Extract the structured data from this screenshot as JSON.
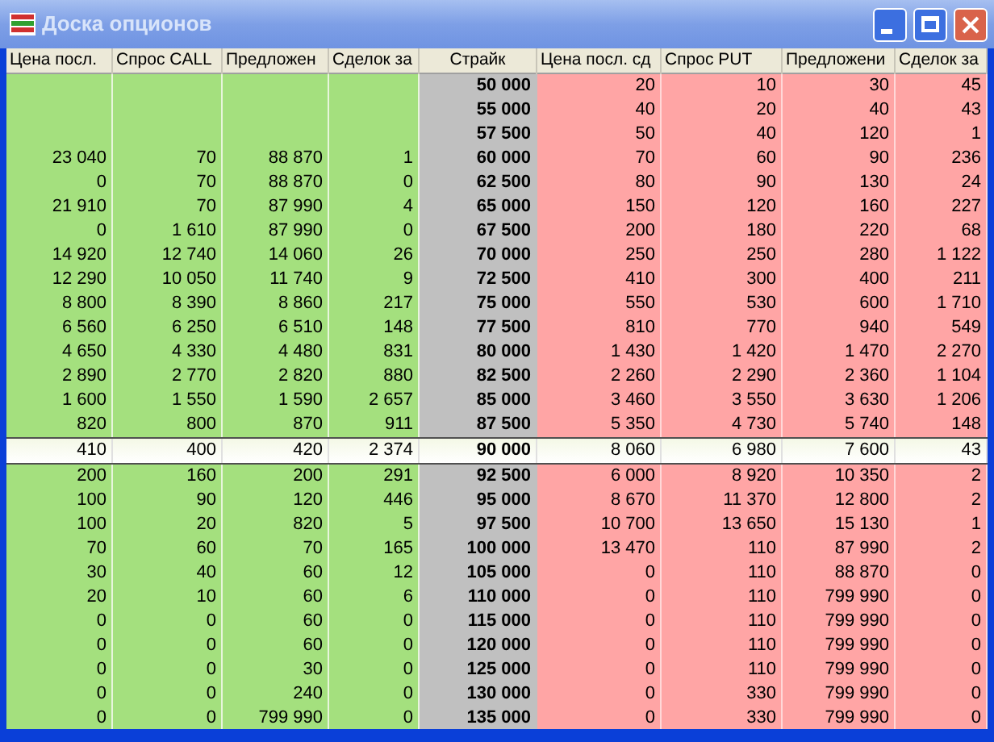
{
  "window": {
    "title": "Доска опционов"
  },
  "columns": [
    "Цена посл.",
    "Спрос CALL",
    "Предложен",
    "Сделок за",
    "Страйк",
    "Цена посл. сд",
    "Спрос PUT",
    "Предложени",
    "Сделок за"
  ],
  "rows": [
    {
      "strike": "50 000",
      "put": [
        "20",
        "10",
        "30",
        "45"
      ],
      "selected": false
    },
    {
      "strike": "55 000",
      "put": [
        "40",
        "20",
        "40",
        "43"
      ],
      "selected": false
    },
    {
      "strike": "57 500",
      "put": [
        "50",
        "40",
        "120",
        "1"
      ],
      "selected": false
    },
    {
      "strike": "60 000",
      "call": [
        "23 040",
        "70",
        "88 870",
        "1"
      ],
      "put": [
        "70",
        "60",
        "90",
        "236"
      ],
      "selected": false
    },
    {
      "strike": "62 500",
      "call": [
        "0",
        "70",
        "88 870",
        "0"
      ],
      "put": [
        "80",
        "90",
        "130",
        "24"
      ],
      "selected": false
    },
    {
      "strike": "65 000",
      "call": [
        "21 910",
        "70",
        "87 990",
        "4"
      ],
      "put": [
        "150",
        "120",
        "160",
        "227"
      ],
      "selected": false
    },
    {
      "strike": "67 500",
      "call": [
        "0",
        "1 610",
        "87 990",
        "0"
      ],
      "put": [
        "200",
        "180",
        "220",
        "68"
      ],
      "selected": false
    },
    {
      "strike": "70 000",
      "call": [
        "14 920",
        "12 740",
        "14 060",
        "26"
      ],
      "put": [
        "250",
        "250",
        "280",
        "1 122"
      ],
      "selected": false
    },
    {
      "strike": "72 500",
      "call": [
        "12 290",
        "10 050",
        "11 740",
        "9"
      ],
      "put": [
        "410",
        "300",
        "400",
        "211"
      ],
      "selected": false
    },
    {
      "strike": "75 000",
      "call": [
        "8 800",
        "8 390",
        "8 860",
        "217"
      ],
      "put": [
        "550",
        "530",
        "600",
        "1 710"
      ],
      "selected": false
    },
    {
      "strike": "77 500",
      "call": [
        "6 560",
        "6 250",
        "6 510",
        "148"
      ],
      "put": [
        "810",
        "770",
        "940",
        "549"
      ],
      "selected": false
    },
    {
      "strike": "80 000",
      "call": [
        "4 650",
        "4 330",
        "4 480",
        "831"
      ],
      "put": [
        "1 430",
        "1 420",
        "1 470",
        "2 270"
      ],
      "selected": false
    },
    {
      "strike": "82 500",
      "call": [
        "2 890",
        "2 770",
        "2 820",
        "880"
      ],
      "put": [
        "2 260",
        "2 290",
        "2 360",
        "1 104"
      ],
      "selected": false
    },
    {
      "strike": "85 000",
      "call": [
        "1 600",
        "1 550",
        "1 590",
        "2 657"
      ],
      "put": [
        "3 460",
        "3 550",
        "3 630",
        "1 206"
      ],
      "selected": false
    },
    {
      "strike": "87 500",
      "call": [
        "820",
        "800",
        "870",
        "911"
      ],
      "put": [
        "5 350",
        "4 730",
        "5 740",
        "148"
      ],
      "selected": false
    },
    {
      "strike": "90 000",
      "call": [
        "410",
        "400",
        "420",
        "2 374"
      ],
      "put": [
        "8 060",
        "6 980",
        "7 600",
        "43"
      ],
      "selected": true
    },
    {
      "strike": "92 500",
      "call": [
        "200",
        "160",
        "200",
        "291"
      ],
      "put": [
        "6 000",
        "8 920",
        "10 350",
        "2"
      ],
      "selected": false
    },
    {
      "strike": "95 000",
      "call": [
        "100",
        "90",
        "120",
        "446"
      ],
      "put": [
        "8 670",
        "11 370",
        "12 800",
        "2"
      ],
      "selected": false
    },
    {
      "strike": "97 500",
      "call": [
        "100",
        "20",
        "820",
        "5"
      ],
      "put": [
        "10 700",
        "13 650",
        "15 130",
        "1"
      ],
      "selected": false
    },
    {
      "strike": "100 000",
      "call": [
        "70",
        "60",
        "70",
        "165"
      ],
      "put": [
        "13 470",
        "110",
        "87 990",
        "2"
      ],
      "selected": false
    },
    {
      "strike": "105 000",
      "call": [
        "30",
        "40",
        "60",
        "12"
      ],
      "put": [
        "0",
        "110",
        "88 870",
        "0"
      ],
      "selected": false
    },
    {
      "strike": "110 000",
      "call": [
        "20",
        "10",
        "60",
        "6"
      ],
      "put": [
        "0",
        "110",
        "799 990",
        "0"
      ],
      "selected": false
    },
    {
      "strike": "115 000",
      "call": [
        "0",
        "0",
        "60",
        "0"
      ],
      "put": [
        "0",
        "110",
        "799 990",
        "0"
      ],
      "selected": false
    },
    {
      "strike": "120 000",
      "call": [
        "0",
        "0",
        "60",
        "0"
      ],
      "put": [
        "0",
        "110",
        "799 990",
        "0"
      ],
      "selected": false
    },
    {
      "strike": "125 000",
      "call": [
        "0",
        "0",
        "30",
        "0"
      ],
      "put": [
        "0",
        "110",
        "799 990",
        "0"
      ],
      "selected": false
    },
    {
      "strike": "130 000",
      "call": [
        "0",
        "0",
        "240",
        "0"
      ],
      "put": [
        "0",
        "330",
        "799 990",
        "0"
      ],
      "selected": false
    },
    {
      "strike": "135 000",
      "call": [
        "0",
        "0",
        "799 990",
        "0"
      ],
      "put": [
        "0",
        "330",
        "799 990",
        "0"
      ],
      "selected": false
    }
  ]
}
